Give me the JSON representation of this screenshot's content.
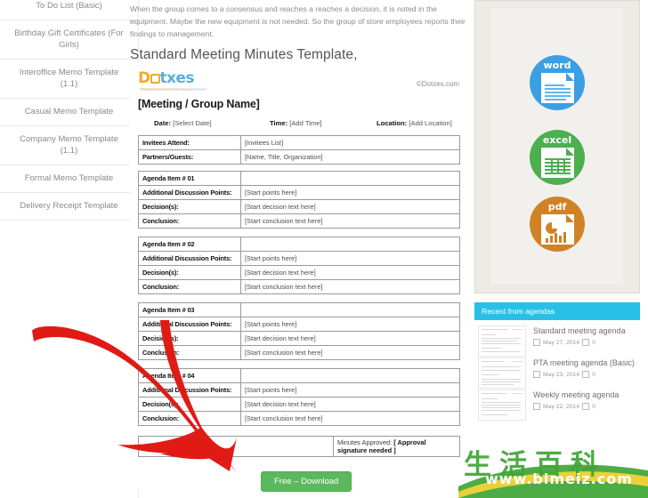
{
  "sidebar": {
    "items": [
      {
        "label": "To Do List (Basic)"
      },
      {
        "label": "Birthday Gift Certificates (For Girls)"
      },
      {
        "label": "Interoffice Memo Template (1.1)"
      },
      {
        "label": "Casual Memo Template"
      },
      {
        "label": "Company Memo Template (1.1)"
      },
      {
        "label": "Formal Memo Template"
      },
      {
        "label": "Delivery Receipt Template"
      }
    ]
  },
  "main": {
    "intro_paragraph": "When the group comes to a consensus and reaches a reaches a decision, it is noted in the equipment. Maybe the new equipment is not needed. So the group of store employees reports their findings to management.",
    "page_title": "Standard Meeting Minutes Template,",
    "download_label": "Free – Download"
  },
  "document": {
    "logo": {
      "first": "D",
      "rest": "txes",
      "tagline": "Professional Business And Office Templates For Free"
    },
    "copyright": "©Dotxes.com",
    "meeting_name": "[Meeting / Group Name]",
    "header_fields": [
      {
        "label": "Date:",
        "value": "[Select Date]"
      },
      {
        "label": "Time:",
        "value": "[Add Time]"
      },
      {
        "label": "Location:",
        "value": "[Add Location]"
      }
    ],
    "attendees_table": [
      {
        "label": "Invitees Attend:",
        "value": "[Invitees List]"
      },
      {
        "label": "Partners/Guests:",
        "value": "[Name, Title, Organization]"
      }
    ],
    "agenda_blocks": [
      {
        "title": "Agenda Item # 01",
        "rows": [
          {
            "label": "Additional Discussion Points:",
            "value": "[Start points here]"
          },
          {
            "label": "Decision(s):",
            "value": "[Start decision text here]"
          },
          {
            "label": "Conclusion:",
            "value": "[Start conclusion text here]"
          }
        ]
      },
      {
        "title": "Agenda Item # 02",
        "rows": [
          {
            "label": "Additional Discussion Points:",
            "value": "[Start points here]"
          },
          {
            "label": "Decision(s):",
            "value": "[Start decision text here]"
          },
          {
            "label": "Conclusion:",
            "value": "[Start conclusion text here]"
          }
        ]
      },
      {
        "title": "Agenda Item # 03",
        "rows": [
          {
            "label": "Additional Discussion Points:",
            "value": "[Start points here]"
          },
          {
            "label": "Decision(s):",
            "value": "[Start decision text here]"
          },
          {
            "label": "Conclusion:",
            "value": "[Start conclusion text here]"
          }
        ]
      },
      {
        "title": "Agenda Item # 04",
        "rows": [
          {
            "label": "Additional Discussion Points:",
            "value": "[Start points here]"
          },
          {
            "label": "Decision(s):",
            "value": "[Start decision text here]"
          },
          {
            "label": "Conclusion:",
            "value": "[Start conclusion text here]"
          }
        ]
      }
    ],
    "footer": {
      "prepared_label": "Minutes prepared by:",
      "approved_label": "Minutes Approved:",
      "approved_value": "[ Approval signature needed ]"
    }
  },
  "formats": {
    "items": [
      {
        "label": "word",
        "color": "#3b9fe3"
      },
      {
        "label": "excel",
        "color": "#4caf50"
      },
      {
        "label": "pdf",
        "color": "#cf8326"
      }
    ]
  },
  "recent": {
    "header": "Recent from agendas",
    "items": [
      {
        "title": "Standard meeting agenda",
        "date": "May 27, 2014",
        "comments": "0"
      },
      {
        "title": "PTA meeting agenda (Basic)",
        "date": "May 23, 2014",
        "comments": "0"
      },
      {
        "title": "Weekly meeting agenda",
        "date": "May 22, 2014",
        "comments": "0"
      }
    ]
  },
  "watermark": {
    "chinese": "生活百科",
    "url": "www.bimeiz.com"
  }
}
